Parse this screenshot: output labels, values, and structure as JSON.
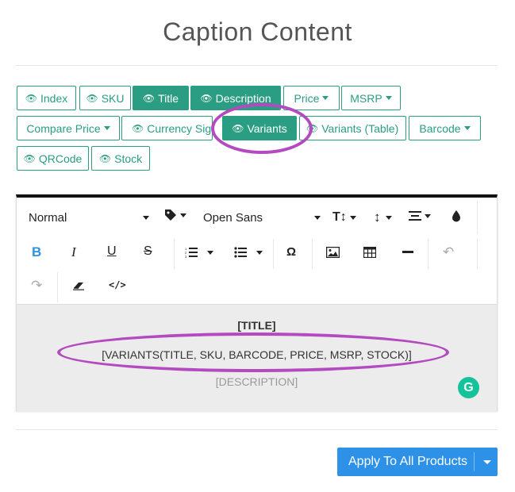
{
  "modal": {
    "title": "Caption Content"
  },
  "tag_buttons": {
    "index": "Index",
    "sku": "SKU",
    "title": "Title",
    "description": "Description",
    "price": "Price",
    "msrp": "MSRP",
    "compare_price": "Compare Price",
    "currency_sign": "Currency Sign",
    "variants": "Variants",
    "variants_table": "Variants (Table)",
    "barcode": "Barcode",
    "qrcode": "QRCode",
    "stock": "Stock"
  },
  "editor": {
    "style_select": "Normal",
    "font_select": "Open Sans",
    "content": {
      "line1": "[TITLE]",
      "line2": "[VARIANTS(TITLE, SKU, BARCODE, PRICE, MSRP, STOCK)]",
      "line3": "[DESCRIPTION]"
    },
    "grammarly_badge": "G"
  },
  "footer": {
    "apply_button": "Apply To All Products"
  },
  "colors": {
    "accent_green": "#2a9d82",
    "primary_blue": "#2d91e8",
    "annotation_purple": "#b44ac0",
    "grammarly_green": "#15c39a"
  },
  "icons": {
    "eye": "eye-icon",
    "eye_slash": "eye-slash-icon",
    "caret": "caret-down-icon"
  }
}
